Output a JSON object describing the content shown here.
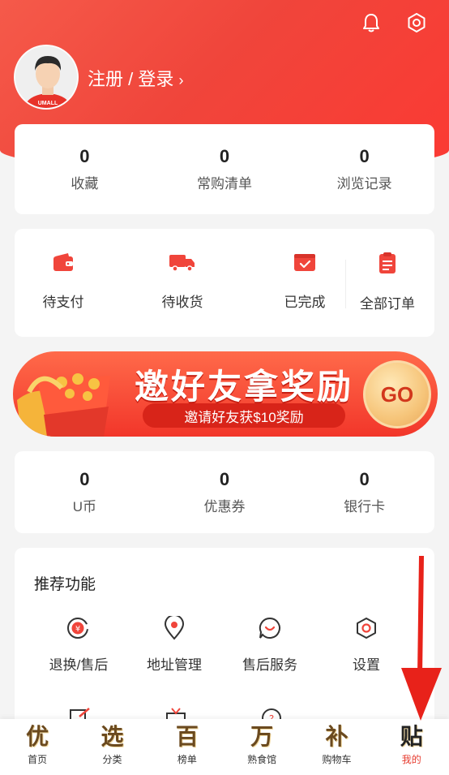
{
  "header": {
    "login_text": "注册 / 登录",
    "avatar_badge": "UMALL"
  },
  "stats": [
    {
      "value": "0",
      "label": "收藏"
    },
    {
      "value": "0",
      "label": "常购清单"
    },
    {
      "value": "0",
      "label": "浏览记录"
    }
  ],
  "orders": [
    {
      "label": "待支付",
      "icon": "wallet-icon"
    },
    {
      "label": "待收货",
      "icon": "truck-icon"
    },
    {
      "label": "已完成",
      "icon": "check-box-icon"
    },
    {
      "label": "全部订单",
      "icon": "order-list-icon"
    }
  ],
  "banner": {
    "title": "邀好友拿奖励",
    "subtitle": "邀请好友获$10奖励",
    "go": "GO"
  },
  "wallet": [
    {
      "value": "0",
      "label": "U币"
    },
    {
      "value": "0",
      "label": "优惠券"
    },
    {
      "value": "0",
      "label": "银行卡"
    }
  ],
  "functions": {
    "title": "推荐功能",
    "items": [
      {
        "label": "退换/售后",
        "icon": "refund-icon"
      },
      {
        "label": "地址管理",
        "icon": "location-icon"
      },
      {
        "label": "售后服务",
        "icon": "chat-icon"
      },
      {
        "label": "设置",
        "icon": "settings-icon"
      }
    ]
  },
  "tabbar": [
    {
      "glyph": "优",
      "label": "首页"
    },
    {
      "glyph": "选",
      "label": "分类"
    },
    {
      "glyph": "百",
      "label": "榜单"
    },
    {
      "glyph": "万",
      "label": "熟食馆"
    },
    {
      "glyph": "补",
      "label": "购物车"
    },
    {
      "glyph": "贴",
      "label": "我的",
      "active": true
    }
  ],
  "colors": {
    "primary": "#f0453b",
    "accent": "#e63b2e"
  }
}
